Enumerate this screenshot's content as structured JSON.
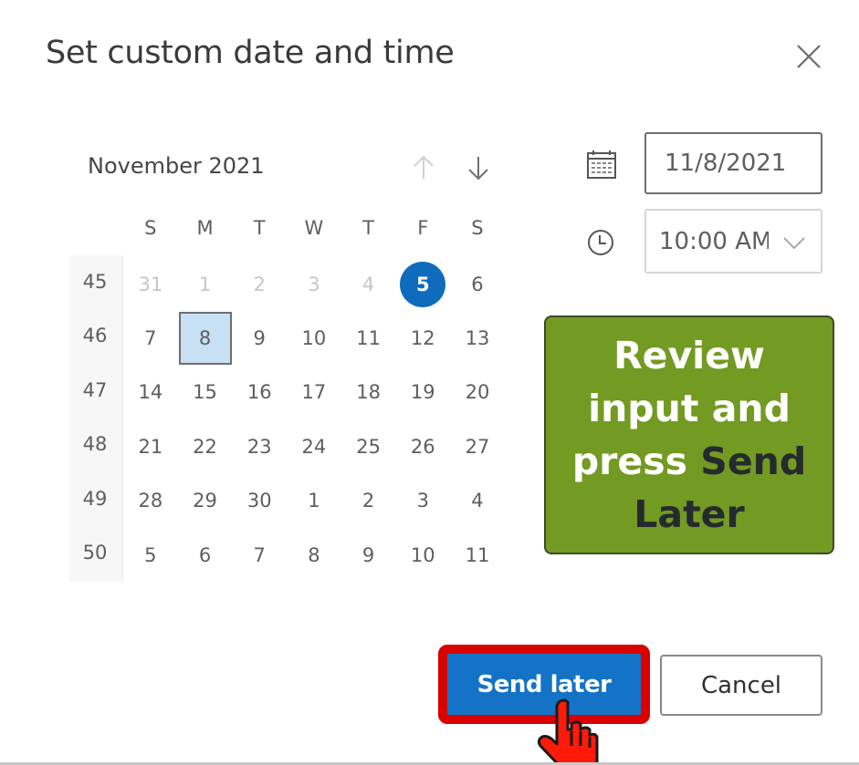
{
  "dialog": {
    "title": "Set custom date and time",
    "close_icon": "close-icon"
  },
  "calendar": {
    "month_label": "November 2021",
    "prev_icon": "arrow-up-icon",
    "next_icon": "arrow-down-icon",
    "weekdays": [
      "S",
      "M",
      "T",
      "W",
      "T",
      "F",
      "S"
    ],
    "weeks": [
      {
        "number": "45",
        "days": [
          {
            "d": "31",
            "muted": true
          },
          {
            "d": "1",
            "muted": true
          },
          {
            "d": "2",
            "muted": true
          },
          {
            "d": "3",
            "muted": true
          },
          {
            "d": "4",
            "muted": true
          },
          {
            "d": "5",
            "today": true
          },
          {
            "d": "6"
          }
        ]
      },
      {
        "number": "46",
        "days": [
          {
            "d": "7"
          },
          {
            "d": "8",
            "selected": true
          },
          {
            "d": "9"
          },
          {
            "d": "10"
          },
          {
            "d": "11"
          },
          {
            "d": "12"
          },
          {
            "d": "13"
          }
        ]
      },
      {
        "number": "47",
        "days": [
          {
            "d": "14"
          },
          {
            "d": "15"
          },
          {
            "d": "16"
          },
          {
            "d": "17"
          },
          {
            "d": "18"
          },
          {
            "d": "19"
          },
          {
            "d": "20"
          }
        ]
      },
      {
        "number": "48",
        "days": [
          {
            "d": "21"
          },
          {
            "d": "22"
          },
          {
            "d": "23"
          },
          {
            "d": "24"
          },
          {
            "d": "25"
          },
          {
            "d": "26"
          },
          {
            "d": "27"
          }
        ]
      },
      {
        "number": "49",
        "days": [
          {
            "d": "28"
          },
          {
            "d": "29"
          },
          {
            "d": "30"
          },
          {
            "d": "1"
          },
          {
            "d": "2"
          },
          {
            "d": "3"
          },
          {
            "d": "4"
          }
        ]
      },
      {
        "number": "50",
        "days": [
          {
            "d": "5"
          },
          {
            "d": "6"
          },
          {
            "d": "7"
          },
          {
            "d": "8"
          },
          {
            "d": "9"
          },
          {
            "d": "10"
          },
          {
            "d": "11"
          }
        ]
      }
    ]
  },
  "inputs": {
    "date_icon": "calendar-icon",
    "date_value": "11/8/2021",
    "time_icon": "clock-icon",
    "time_value": "10:00 AM",
    "time_chevron_icon": "chevron-down-icon"
  },
  "callout": {
    "text_plain": "Review input and press ",
    "text_emphasis": "Send Later",
    "colors": {
      "background": "#739a22",
      "text": "#ffffff",
      "emphasis": "#252a2e"
    }
  },
  "actions": {
    "send_later_label": "Send later",
    "cancel_label": "Cancel",
    "highlight_color": "#d90000",
    "primary_color": "#1473c6"
  },
  "annotation": {
    "cursor_icon": "hand-pointer-icon"
  }
}
